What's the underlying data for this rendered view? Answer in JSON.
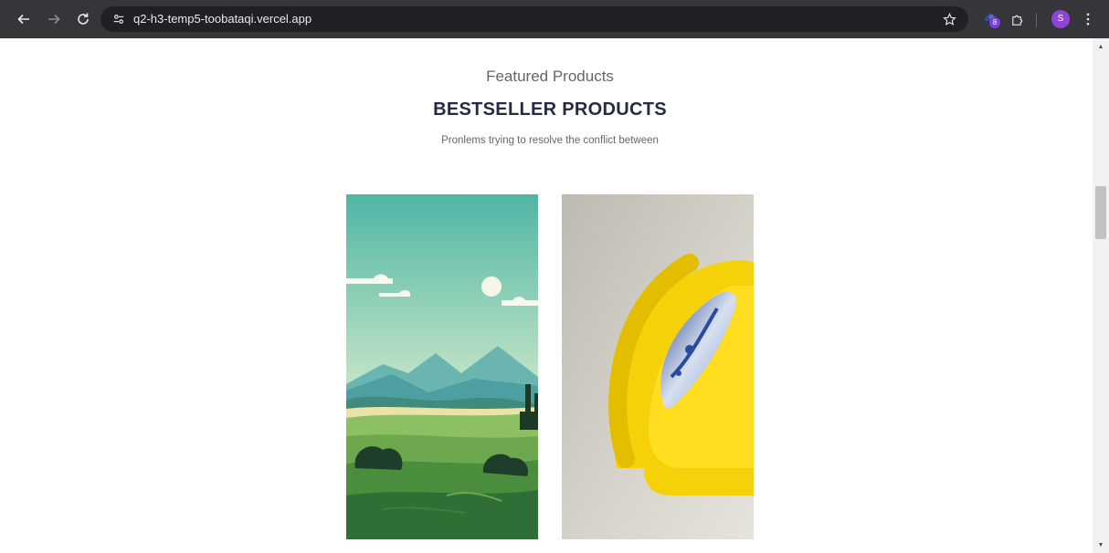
{
  "browser": {
    "url": "q2-h3-temp5-toobataqi.vercel.app",
    "extension_badge": "8",
    "profile_initial": "S"
  },
  "section": {
    "eyebrow": "Featured Products",
    "heading": "BESTSELLER PRODUCTS",
    "subtext": "Pronlems trying to resolve the conflict between"
  },
  "products": [
    {
      "image": "landscape-illustration"
    },
    {
      "image": "yellow-chair-with-pillow"
    }
  ],
  "colors": {
    "toolbar": "#35363a",
    "omnibox": "#202124",
    "heading": "#252b42",
    "muted_text": "#666666"
  }
}
